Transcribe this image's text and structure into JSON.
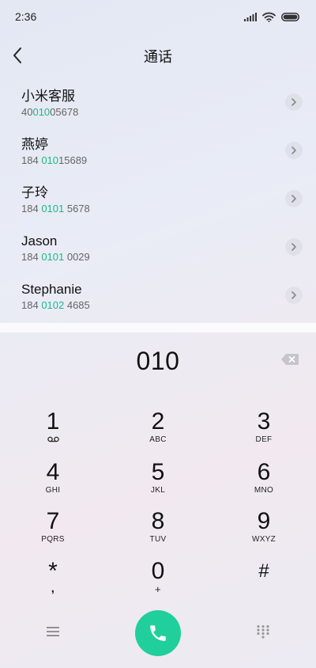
{
  "status_bar": {
    "time": "2:36"
  },
  "header": {
    "title": "通话"
  },
  "contacts": [
    {
      "name": "小米客服",
      "number_pre": "40",
      "number_match": "010",
      "number_post": "05678"
    },
    {
      "name": "燕婷",
      "number_pre": "184 ",
      "number_match": "010",
      "number_post": "15689"
    },
    {
      "name": "子玲",
      "number_pre": "184 ",
      "number_match": "0101",
      "number_post": " 5678"
    },
    {
      "name": "Jason",
      "number_pre": "184 ",
      "number_match": "0101",
      "number_post": " 0029"
    },
    {
      "name": "Stephanie",
      "number_pre": "184 ",
      "number_match": "0102",
      "number_post": " 4685"
    }
  ],
  "dialer": {
    "entered_number": "010"
  },
  "keypad": [
    {
      "digit": "1",
      "letters": "",
      "sub_icon": "voicemail-icon"
    },
    {
      "digit": "2",
      "letters": "ABC"
    },
    {
      "digit": "3",
      "letters": "DEF"
    },
    {
      "digit": "4",
      "letters": "GHI"
    },
    {
      "digit": "5",
      "letters": "JKL"
    },
    {
      "digit": "6",
      "letters": "MNO"
    },
    {
      "digit": "7",
      "letters": "PQRS"
    },
    {
      "digit": "8",
      "letters": "TUV"
    },
    {
      "digit": "9",
      "letters": "WXYZ"
    },
    {
      "digit": "*",
      "letters": ","
    },
    {
      "digit": "0",
      "letters": "+"
    },
    {
      "digit": "#",
      "letters": ""
    }
  ],
  "colors": {
    "accent": "#20cf9b",
    "match_highlight": "#1bb88a"
  },
  "icons": [
    "back-arrow-icon",
    "signal-icon",
    "wifi-icon",
    "battery-icon",
    "chevron-right-icon",
    "backspace-icon",
    "voicemail-icon",
    "menu-icon",
    "phone-icon",
    "dialpad-icon"
  ]
}
